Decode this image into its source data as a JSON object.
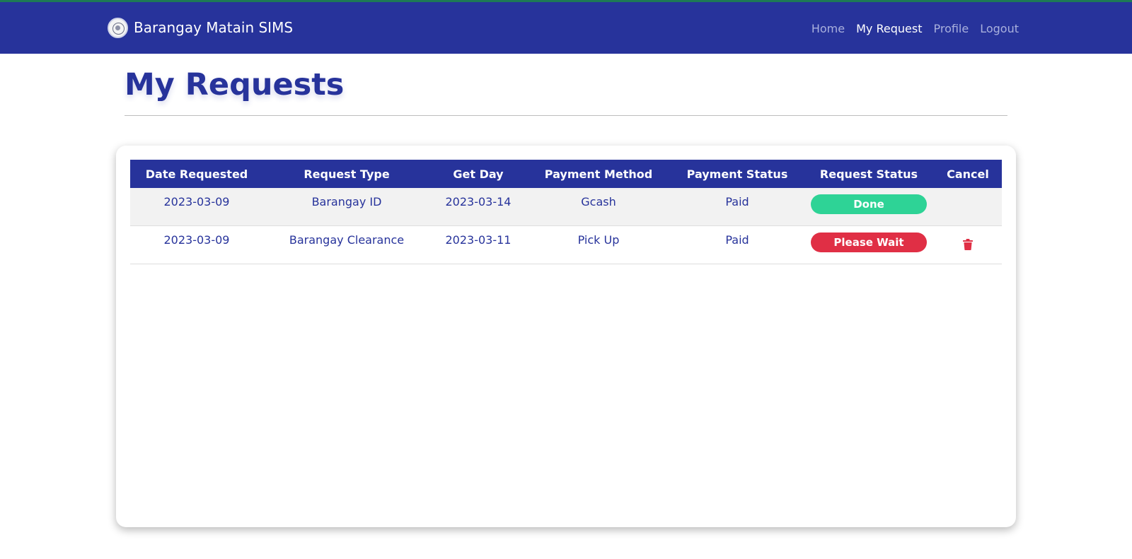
{
  "header": {
    "brand": "Barangay Matain SIMS",
    "nav": [
      {
        "label": "Home",
        "active": false
      },
      {
        "label": "My Request",
        "active": true
      },
      {
        "label": "Profile",
        "active": false
      },
      {
        "label": "Logout",
        "active": false
      }
    ]
  },
  "page": {
    "title": "My Requests"
  },
  "table": {
    "columns": [
      "Date Requested",
      "Request Type",
      "Get Day",
      "Payment Method",
      "Payment Status",
      "Request Status",
      "Cancel"
    ],
    "rows": [
      {
        "date_requested": "2023-03-09",
        "request_type": "Barangay ID",
        "get_day": "2023-03-14",
        "payment_method": "Gcash",
        "payment_status": "Paid",
        "request_status": "Done",
        "cancel_icon": ""
      },
      {
        "date_requested": "2023-03-09",
        "request_type": "Barangay Clearance",
        "get_day": "2023-03-11",
        "payment_method": "Pick Up",
        "payment_status": "Paid",
        "request_status": "Please Wait",
        "cancel_icon": "trash-icon"
      }
    ]
  },
  "colors": {
    "primary": "#27339b",
    "done": "#2ed396",
    "wait": "#e02f45"
  }
}
